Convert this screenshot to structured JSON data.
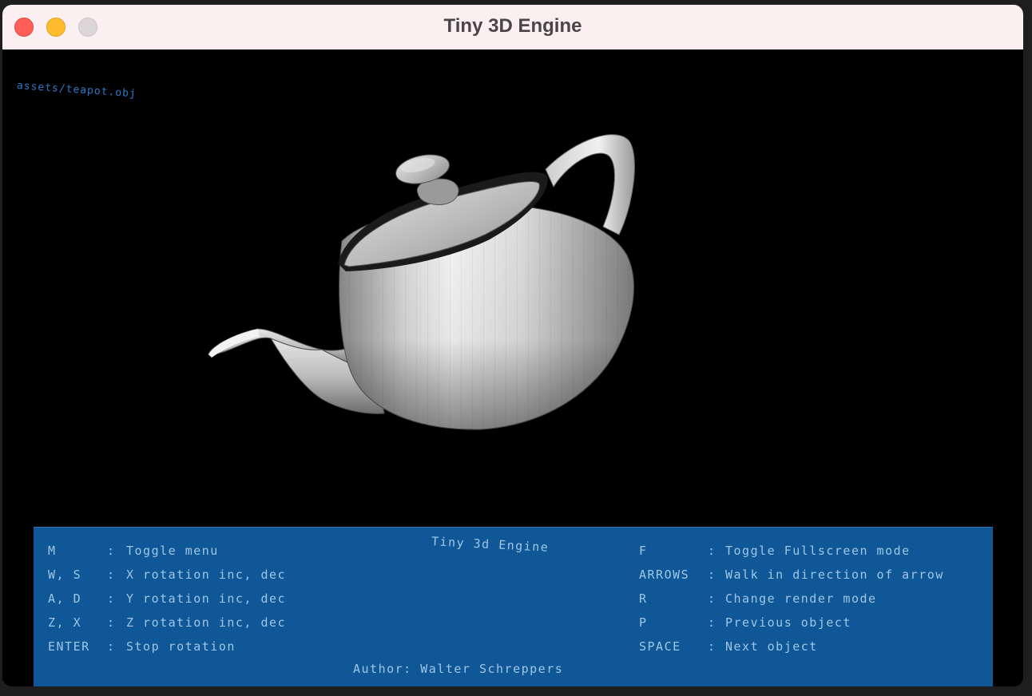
{
  "window": {
    "title": "Tiny 3D Engine"
  },
  "canvas": {
    "asset_label": "assets/teapot.obj"
  },
  "menu": {
    "title": "Tiny 3d Engine",
    "left": [
      {
        "key": "M",
        "desc": "Toggle menu"
      },
      {
        "key": "W, S",
        "desc": "X rotation inc, dec"
      },
      {
        "key": "A, D",
        "desc": "Y rotation inc, dec"
      },
      {
        "key": "Z, X",
        "desc": "Z rotation inc, dec"
      },
      {
        "key": "ENTER",
        "desc": "Stop rotation"
      }
    ],
    "right": [
      {
        "key": "F",
        "desc": "Toggle Fullscreen mode"
      },
      {
        "key": "ARROWS",
        "desc": "Walk in direction of arrow"
      },
      {
        "key": "R",
        "desc": "Change render mode"
      },
      {
        "key": "P",
        "desc": "Previous object"
      },
      {
        "key": "SPACE",
        "desc": "Next object"
      }
    ],
    "author": "Author: Walter Schreppers",
    "separator": ":"
  },
  "colors": {
    "menu_bg": "#0f5796",
    "menu_text": "#9fc6e8",
    "asset_label": "#2a78c8"
  }
}
